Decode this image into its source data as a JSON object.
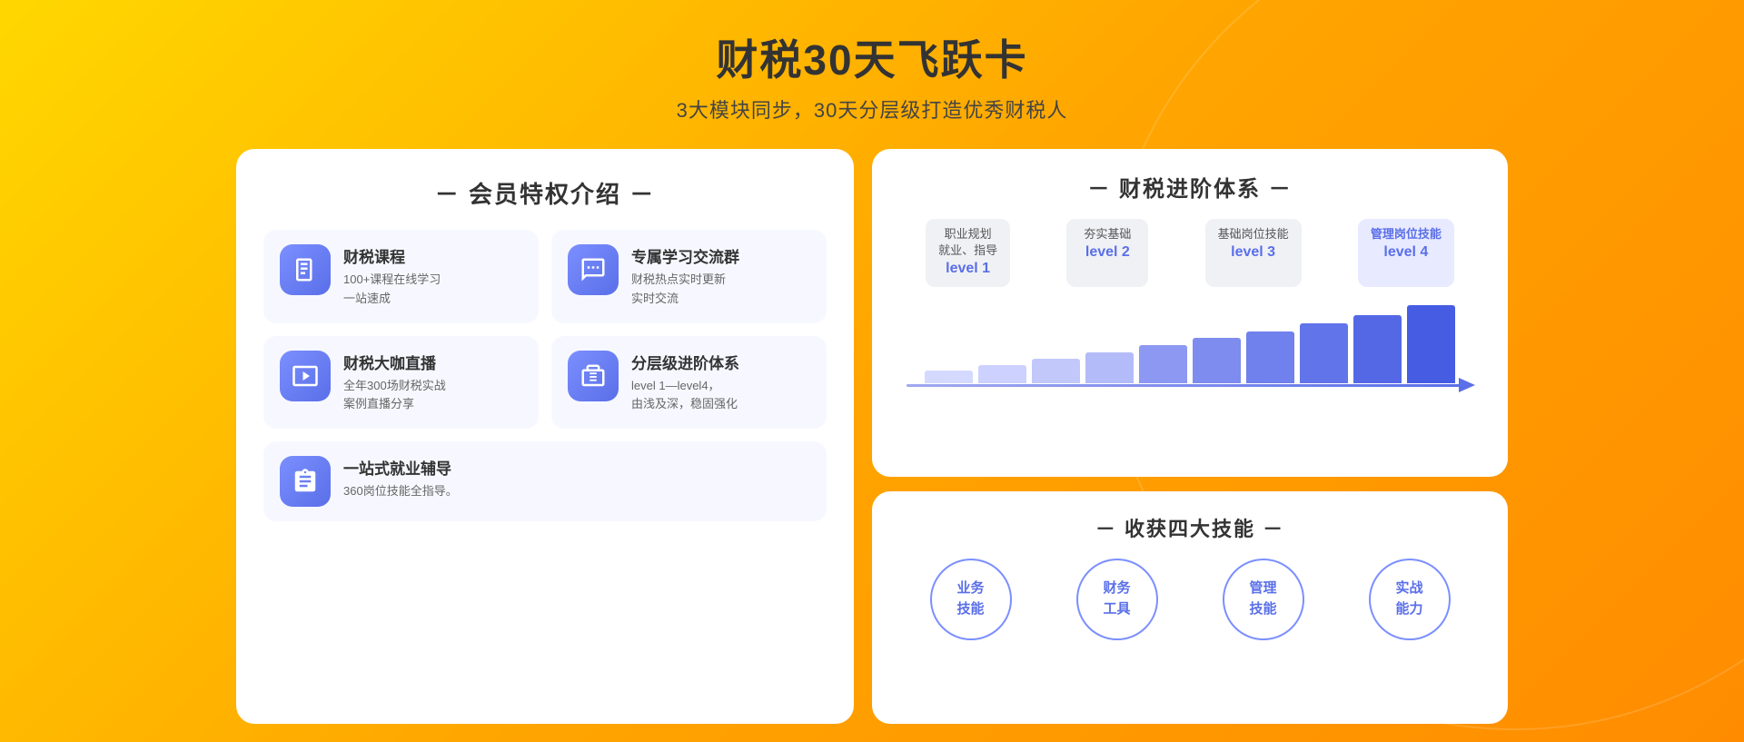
{
  "page": {
    "title": "财税30天飞跃卡",
    "subtitle": "3大模块同步，30天分层级打造优秀财税人",
    "background": {
      "from": "#FFD700",
      "to": "#FF8C00"
    }
  },
  "left_panel": {
    "section_title": "－ 会员特权介绍 －",
    "features": [
      {
        "id": "course",
        "title": "财税课程",
        "desc": "100+课程在线学习\n一站速成",
        "icon": "book-icon"
      },
      {
        "id": "group",
        "title": "专属学习交流群",
        "desc": "财税热点实时更新\n实时交流",
        "icon": "chat-icon"
      },
      {
        "id": "live",
        "title": "财税大咖直播",
        "desc": "全年300场财税实战\n案例直播分享",
        "icon": "play-icon"
      },
      {
        "id": "levels",
        "title": "分层级进阶体系",
        "desc": "level 1—level4，\n由浅及深，稳固强化",
        "icon": "briefcase-icon"
      }
    ],
    "wide_feature": {
      "id": "career",
      "title": "一站式就业辅导",
      "desc": "360岗位技能全指导。",
      "icon": "clipboard-icon"
    }
  },
  "right_top_panel": {
    "section_title": "－ 财税进阶体系 －",
    "levels": [
      {
        "label": "职业规划\n就业、指导",
        "level": "level 1",
        "active": false
      },
      {
        "label": "夯实基础",
        "level": "level 2",
        "active": false
      },
      {
        "label": "基础岗位技能",
        "level": "level 3",
        "active": false
      },
      {
        "label": "管理岗位技能",
        "level": "level 4",
        "active": true
      }
    ],
    "bars": [
      15,
      20,
      25,
      30,
      35,
      42,
      50,
      58,
      68,
      80
    ],
    "bar_color": "#8A96F0"
  },
  "right_bottom_panel": {
    "section_title": "－ 收获四大技能 －",
    "skills": [
      {
        "line1": "业务",
        "line2": "技能"
      },
      {
        "line1": "财务",
        "line2": "工具"
      },
      {
        "line1": "管理",
        "line2": "技能"
      },
      {
        "line1": "实战",
        "line2": "能力"
      }
    ],
    "circle_border_color": "#7B8FFF",
    "circle_text_color": "#5A6FE8"
  }
}
